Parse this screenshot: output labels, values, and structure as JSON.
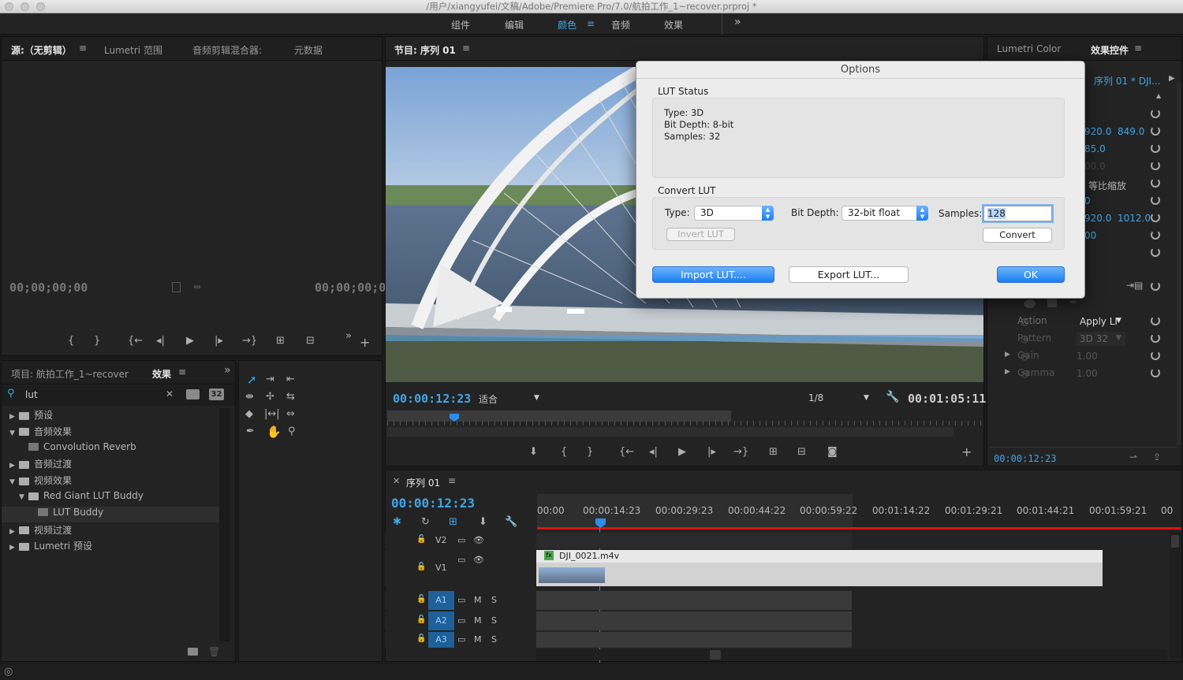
{
  "window": {
    "title": "/用户/xiangyufei/文稿/Adobe/Premiere Pro/7.0/航拍工作_1~recover.prproj *"
  },
  "workspaces": {
    "items": [
      "组件",
      "编辑",
      "颜色",
      "音频",
      "效果"
    ],
    "active": "颜色",
    "overflow": "»"
  },
  "source_panel": {
    "tabs": [
      "源:（无剪辑）",
      "Lumetri 范围",
      "音频剪辑混合器:",
      "元数据"
    ],
    "timecode_in": "00;00;00;00",
    "timecode_out": "00;00;00;00"
  },
  "program_panel": {
    "title": "节目: 序列 01",
    "timecode": "00:00:12:23",
    "fit": "适合",
    "resolution": "1/8",
    "duration": "00:01:05:11"
  },
  "effects_controls": {
    "tabs": [
      "Lumetri Color",
      "效果控件"
    ],
    "sequence": "序列 01 * DJI...",
    "values": [
      {
        "a": "920.0",
        "b": "849.0"
      },
      {
        "a": "85.0"
      },
      {
        "a": "00.0"
      },
      {
        "a": "等比缩放"
      },
      {
        "a": "0"
      },
      {
        "a": "920.0",
        "b": "1012.0"
      },
      {
        "a": "00"
      }
    ],
    "action_label": "Action",
    "action_value": "Apply LI",
    "pattern_label": "Pattern",
    "pattern_value": "3D 32",
    "gain_label": "Gain",
    "gain_value": "1.00",
    "gamma_label": "Gamma",
    "gamma_value": "1.00",
    "timecode": "00:00:12:23"
  },
  "project_panel": {
    "tabs": [
      "项目: 航拍工作_1~recover",
      "效果"
    ],
    "search_value": "lut",
    "badges": [
      "32"
    ],
    "tree": [
      {
        "label": "预设",
        "level": 0,
        "expanded": false
      },
      {
        "label": "音频效果",
        "level": 0,
        "expanded": true
      },
      {
        "label": "Convolution Reverb",
        "level": 1,
        "expanded": false
      },
      {
        "label": "音频过渡",
        "level": 0,
        "expanded": false
      },
      {
        "label": "视频效果",
        "level": 0,
        "expanded": true
      },
      {
        "label": "Red Giant LUT Buddy",
        "level": 1,
        "expanded": true
      },
      {
        "label": "LUT Buddy",
        "level": 2,
        "expanded": false
      },
      {
        "label": "视频过渡",
        "level": 0,
        "expanded": false
      },
      {
        "label": "Lumetri 预设",
        "level": 0,
        "expanded": false
      }
    ]
  },
  "timeline": {
    "sequence": "序列 01",
    "timecode": "00:00:12:23",
    "ruler": [
      "00:00",
      "00:00:14:23",
      "00:00:29:23",
      "00:00:44:22",
      "00:00:59:22",
      "00:01:14:22",
      "00:01:29:21",
      "00:01:44:21",
      "00:01:59:21",
      "00"
    ],
    "tracks": [
      "V2",
      "V1",
      "A1",
      "A2",
      "A3"
    ],
    "clip_name": "DJI_0021.m4v",
    "clip_badge": "fx",
    "mute": "M",
    "solo": "S"
  },
  "dialog": {
    "title": "Options",
    "lut_status_label": "LUT Status",
    "status_type": "Type: 3D",
    "status_depth": "Bit Depth: 8-bit",
    "status_samples": "Samples: 32",
    "convert_label": "Convert LUT",
    "type_label": "Type:",
    "type_value": "3D",
    "depth_label": "Bit Depth:",
    "depth_value": "32-bit float",
    "samples_label": "Samples:",
    "samples_value": "128",
    "invert_button": "Invert LUT",
    "convert_button": "Convert",
    "import_button": "Import LUT....",
    "export_button": "Export LUT...",
    "ok_button": "OK"
  },
  "colors": {
    "accent": "#3fa6e8",
    "playhead": "#2d8ceb",
    "dialog_primary": "#1b7ef2"
  }
}
